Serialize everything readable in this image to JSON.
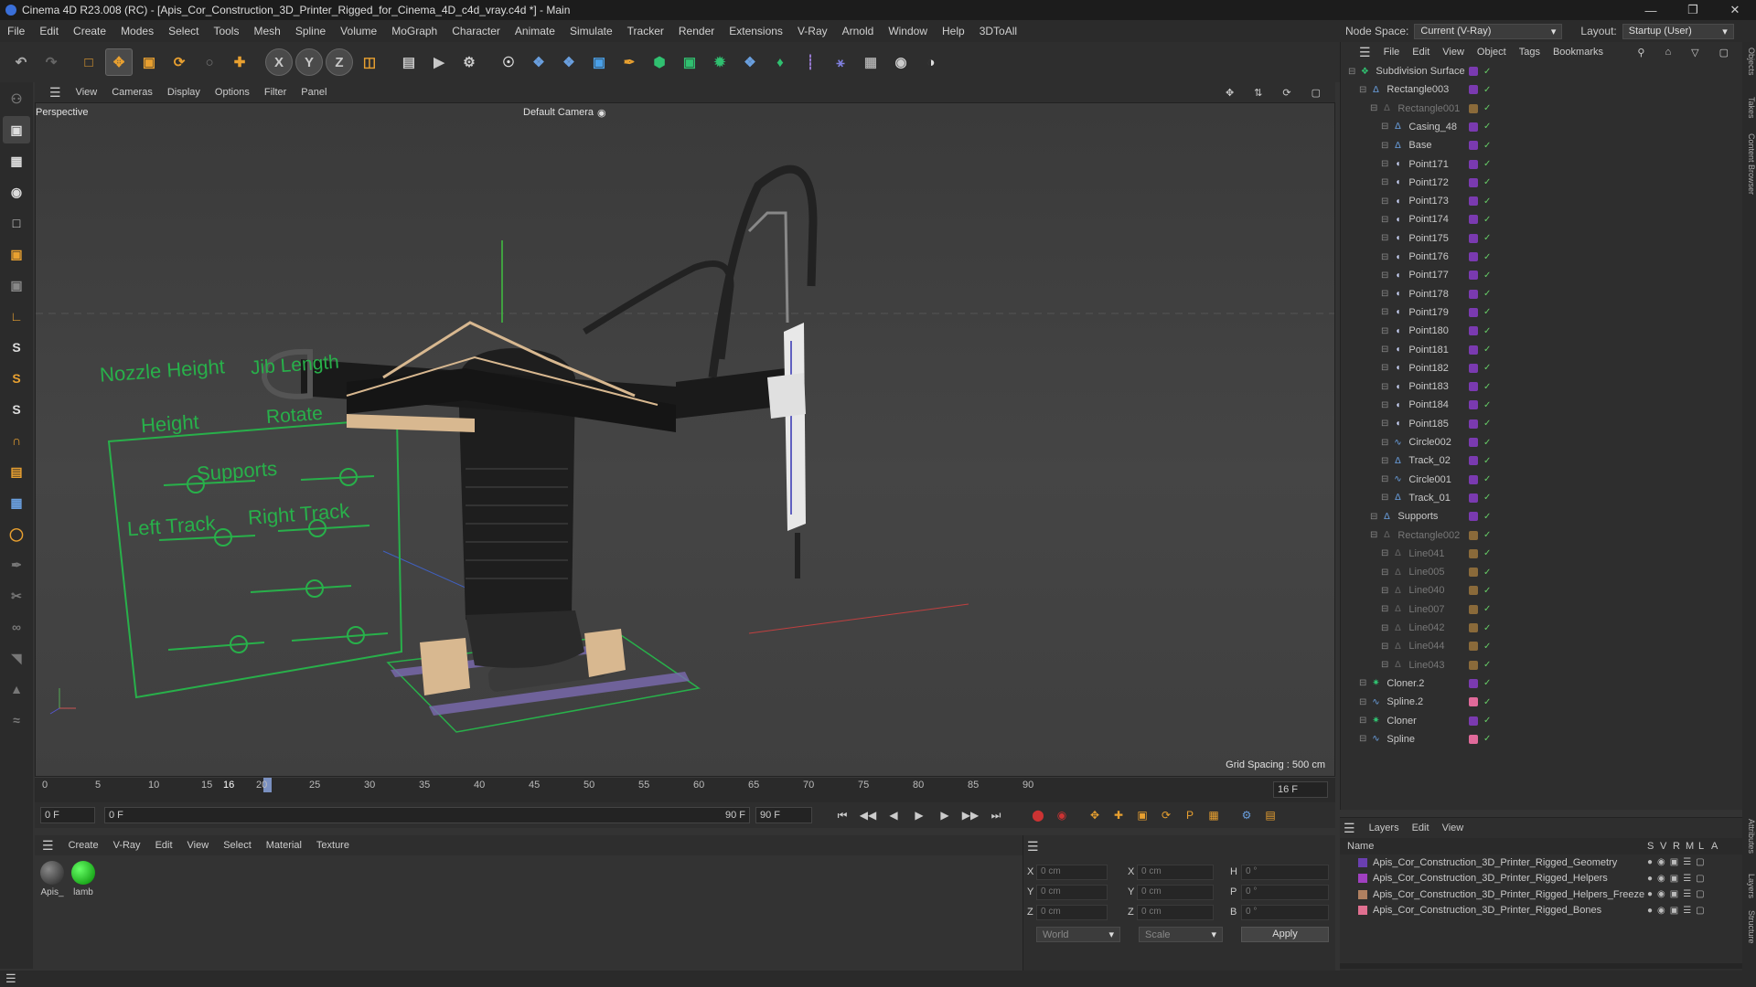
{
  "app": {
    "title": "Cinema 4D R23.008 (RC) - [Apis_Cor_Construction_3D_Printer_Rigged_for_Cinema_4D_c4d_vray.c4d *] - Main"
  },
  "menu": [
    "File",
    "Edit",
    "Create",
    "Modes",
    "Select",
    "Tools",
    "Mesh",
    "Spline",
    "Volume",
    "MoGraph",
    "Character",
    "Animate",
    "Simulate",
    "Tracker",
    "Render",
    "Extensions",
    "V-Ray",
    "Arnold",
    "Window",
    "Help",
    "3DToAll"
  ],
  "nodespace": {
    "label": "Node Space:",
    "value": "Current (V-Ray)",
    "layout_label": "Layout:",
    "layout_value": "Startup (User)"
  },
  "toolbar": {
    "axis_x": "X",
    "axis_y": "Y",
    "axis_z": "Z"
  },
  "viewport": {
    "menu": [
      "View",
      "Cameras",
      "Display",
      "Options",
      "Filter",
      "Panel"
    ],
    "name": "Perspective",
    "camera": "Default Camera",
    "grid": "Grid Spacing : 500 cm"
  },
  "hud": {
    "nozzle": "Nozzle Height",
    "jib": "Jib Length",
    "height": "Height",
    "rotate": "Rotate",
    "supports": "Supports",
    "left_track": "Left Track",
    "right_track": "Right Track"
  },
  "timeline": {
    "ticks": [
      "0",
      "5",
      "10",
      "15",
      "16",
      "20",
      "25",
      "30",
      "35",
      "40",
      "45",
      "50",
      "55",
      "60",
      "65",
      "70",
      "75",
      "80",
      "85",
      "90"
    ],
    "current": "16 F"
  },
  "playback": {
    "start": "0 F",
    "start2": "0 F",
    "end": "90 F",
    "end2": "90 F"
  },
  "materials": {
    "menu": [
      "Create",
      "V-Ray",
      "Edit",
      "View",
      "Select",
      "Material",
      "Texture"
    ],
    "items": [
      {
        "name": "Apis_"
      },
      {
        "name": "lamb"
      }
    ]
  },
  "coords": {
    "x": "X",
    "y": "Y",
    "z": "Z",
    "val": "0 cm",
    "h": "H",
    "p": "P",
    "b": "B",
    "deg": "0 °",
    "world": "World",
    "scale": "Scale",
    "apply": "Apply"
  },
  "objects": {
    "menu": [
      "File",
      "Edit",
      "View",
      "Object",
      "Tags",
      "Bookmarks"
    ],
    "rows": [
      {
        "name": "Subdivision Surface",
        "indent": 0,
        "icon": "subdiv"
      },
      {
        "name": "Rectangle003",
        "indent": 1,
        "icon": "null"
      },
      {
        "name": "Rectangle001",
        "indent": 2,
        "icon": "null",
        "dim": true
      },
      {
        "name": "Casing_48",
        "indent": 3,
        "icon": "null"
      },
      {
        "name": "Base",
        "indent": 3,
        "icon": "null"
      },
      {
        "name": "Point171",
        "indent": 3,
        "icon": "point"
      },
      {
        "name": "Point172",
        "indent": 3,
        "icon": "point"
      },
      {
        "name": "Point173",
        "indent": 3,
        "icon": "point"
      },
      {
        "name": "Point174",
        "indent": 3,
        "icon": "point"
      },
      {
        "name": "Point175",
        "indent": 3,
        "icon": "point"
      },
      {
        "name": "Point176",
        "indent": 3,
        "icon": "point"
      },
      {
        "name": "Point177",
        "indent": 3,
        "icon": "point"
      },
      {
        "name": "Point178",
        "indent": 3,
        "icon": "point"
      },
      {
        "name": "Point179",
        "indent": 3,
        "icon": "point"
      },
      {
        "name": "Point180",
        "indent": 3,
        "icon": "point"
      },
      {
        "name": "Point181",
        "indent": 3,
        "icon": "point"
      },
      {
        "name": "Point182",
        "indent": 3,
        "icon": "point"
      },
      {
        "name": "Point183",
        "indent": 3,
        "icon": "point"
      },
      {
        "name": "Point184",
        "indent": 3,
        "icon": "point"
      },
      {
        "name": "Point185",
        "indent": 3,
        "icon": "point"
      },
      {
        "name": "Circle002",
        "indent": 3,
        "icon": "spline"
      },
      {
        "name": "Track_02",
        "indent": 3,
        "icon": "null"
      },
      {
        "name": "Circle001",
        "indent": 3,
        "icon": "spline"
      },
      {
        "name": "Track_01",
        "indent": 3,
        "icon": "null"
      },
      {
        "name": "Supports",
        "indent": 2,
        "icon": "null"
      },
      {
        "name": "Rectangle002",
        "indent": 2,
        "icon": "null",
        "dim": true
      },
      {
        "name": "Line041",
        "indent": 3,
        "icon": "null",
        "dim": true
      },
      {
        "name": "Line005",
        "indent": 3,
        "icon": "null",
        "dim": true
      },
      {
        "name": "Line040",
        "indent": 3,
        "icon": "null",
        "dim": true
      },
      {
        "name": "Line007",
        "indent": 3,
        "icon": "null",
        "dim": true
      },
      {
        "name": "Line042",
        "indent": 3,
        "icon": "null",
        "dim": true
      },
      {
        "name": "Line044",
        "indent": 3,
        "icon": "null",
        "dim": true
      },
      {
        "name": "Line043",
        "indent": 3,
        "icon": "null",
        "dim": true
      },
      {
        "name": "Cloner.2",
        "indent": 1,
        "icon": "cloner"
      },
      {
        "name": "Spline.2",
        "indent": 1,
        "icon": "spline"
      },
      {
        "name": "Cloner",
        "indent": 1,
        "icon": "cloner"
      },
      {
        "name": "Spline",
        "indent": 1,
        "icon": "spline"
      }
    ]
  },
  "layers": {
    "menu": [
      "Layers",
      "Edit",
      "View"
    ],
    "header": "Name",
    "cols": [
      "S",
      "V",
      "R",
      "M",
      "L",
      "A"
    ],
    "rows": [
      {
        "name": "Apis_Cor_Construction_3D_Printer_Rigged_Geometry",
        "color": "#6a3fb0"
      },
      {
        "name": "Apis_Cor_Construction_3D_Printer_Rigged_Helpers",
        "color": "#a040c0"
      },
      {
        "name": "Apis_Cor_Construction_3D_Printer_Rigged_Helpers_Freeze",
        "color": "#b08060"
      },
      {
        "name": "Apis_Cor_Construction_3D_Printer_Rigged_Bones",
        "color": "#e07090"
      }
    ]
  },
  "side_tabs": [
    "Objects",
    "Takes",
    "Content Browser",
    "Attributes",
    "Layers",
    "Structure"
  ]
}
